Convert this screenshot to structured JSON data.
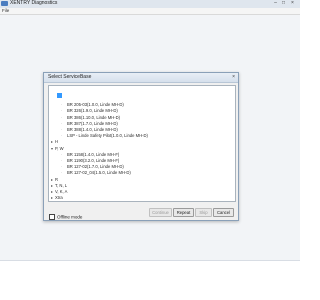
{
  "app": {
    "title": "XENTRY Diagnostics",
    "menu": "File"
  },
  "dialog": {
    "title": "Select ServiceBase",
    "tree": [
      {
        "label": "",
        "level": 1,
        "type": "selected"
      },
      {
        "label": "BR 205-03(1.0.0, Linde MH-D)",
        "level": 2,
        "type": "leaf"
      },
      {
        "label": "BR 326(1.9.0, Linde MH-D)",
        "level": 2,
        "type": "leaf"
      },
      {
        "label": "BR 386(1.10.0, Linde MH-D)",
        "level": 2,
        "type": "leaf"
      },
      {
        "label": "BR 387(1.7.0, Linde MH-D)",
        "level": 2,
        "type": "leaf"
      },
      {
        "label": "BR 388(1.4.0, Linde MH-D)",
        "level": 2,
        "type": "leaf"
      },
      {
        "label": "LSP - Linde Safety Pilot(1.0.0, Linde MH-D)",
        "level": 2,
        "type": "leaf"
      },
      {
        "label": "H",
        "level": 0,
        "type": "collapsed"
      },
      {
        "label": "P, W",
        "level": 0,
        "type": "expanded"
      },
      {
        "label": "BR 1158(1.4.0, Linde MH-F)",
        "level": 2,
        "type": "leaf"
      },
      {
        "label": "BR 1190(3.2.0, Linde MH-F)",
        "level": 2,
        "type": "leaf"
      },
      {
        "label": "BR 127-02(1.7.0, Linde MH-D)",
        "level": 2,
        "type": "leaf"
      },
      {
        "label": "BR 127-02_04(1.5.0, Linde MH-D)",
        "level": 2,
        "type": "leaf"
      },
      {
        "label": "R",
        "level": 0,
        "type": "collapsed"
      },
      {
        "label": "T, N, L",
        "level": 0,
        "type": "collapsed"
      },
      {
        "label": "V, K, A",
        "level": 0,
        "type": "collapsed"
      },
      {
        "label": "Xtra",
        "level": 0,
        "type": "collapsed"
      }
    ],
    "offline_label": "Offline mode",
    "buttons": {
      "continue": "Continue",
      "repeat": "Repeat",
      "skip": "Skip",
      "cancel": "Cancel"
    }
  }
}
